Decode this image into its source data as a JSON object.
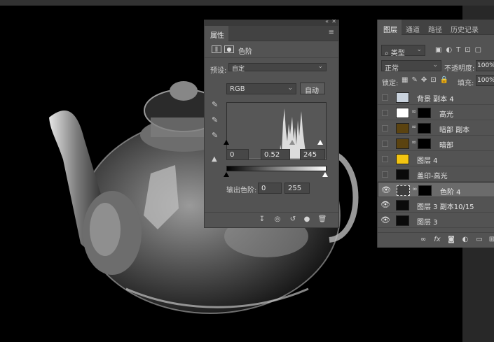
{
  "properties_panel": {
    "collapse_glyph": "«",
    "close_glyph": "✕",
    "tab_label": "属性",
    "menu_glyph": "≡",
    "title": "色阶",
    "preset_label": "预设:",
    "preset_value": "自定",
    "channel_value": "RGB",
    "auto_button": "自动",
    "input_shadow": "0",
    "input_gamma": "0.52",
    "input_highlight": "245",
    "output_label": "输出色阶:",
    "output_shadow": "0",
    "output_highlight": "255"
  },
  "layers_panel": {
    "tabs": [
      "图层",
      "通道",
      "路径",
      "历史记录"
    ],
    "filter_label": "类型",
    "blend_mode": "正常",
    "opacity_label": "不透明度:",
    "opacity_value": "100%",
    "lock_label": "锁定:",
    "fill_label": "填充:",
    "fill_value": "100%",
    "footer_fx": "fx",
    "layers": [
      {
        "name": "背景 副本 4",
        "visible": false,
        "thumb": "teapot-light",
        "mask": false,
        "selected": false
      },
      {
        "name": "高光",
        "visible": false,
        "thumb": "white",
        "mask": true,
        "selected": false
      },
      {
        "name": "暗部 副本",
        "visible": false,
        "thumb": "brown",
        "mask": true,
        "selected": false
      },
      {
        "name": "暗部",
        "visible": false,
        "thumb": "brown",
        "mask": true,
        "selected": false
      },
      {
        "name": "图层 4",
        "visible": false,
        "thumb": "yellow",
        "mask": false,
        "selected": false
      },
      {
        "name": "盖印-高光",
        "visible": false,
        "thumb": "teapot-dark",
        "mask": false,
        "selected": false
      },
      {
        "name": "色阶 4",
        "visible": true,
        "thumb": "adjustment",
        "mask": true,
        "selected": true
      },
      {
        "name": "图层 3 副本10/15",
        "visible": true,
        "thumb": "teapot-dark",
        "mask": false,
        "selected": false
      },
      {
        "name": "图层 3",
        "visible": true,
        "thumb": "teapot-dark",
        "mask": false,
        "selected": false
      }
    ]
  },
  "colors": {
    "brown": "#5b4310",
    "yellow": "#f2c411",
    "panel": "#535353"
  }
}
